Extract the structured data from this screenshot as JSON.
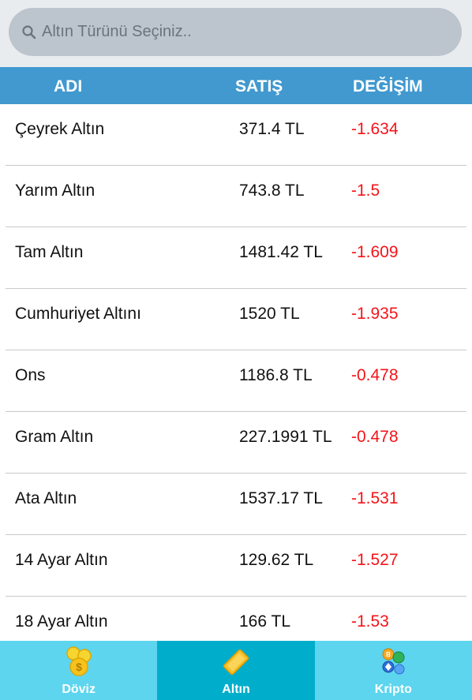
{
  "search": {
    "placeholder": "Altın Türünü Seçiniz.."
  },
  "table": {
    "headers": {
      "name": "ADI",
      "sale": "SATIŞ",
      "change": "DEĞİŞİM"
    },
    "rows": [
      {
        "name": "Çeyrek Altın",
        "sale": "371.4 TL",
        "change": "-1.634"
      },
      {
        "name": "Yarım Altın",
        "sale": "743.8 TL",
        "change": "-1.5"
      },
      {
        "name": "Tam Altın",
        "sale": "1481.42 TL",
        "change": "-1.609"
      },
      {
        "name": "Cumhuriyet Altını",
        "sale": "1520 TL",
        "change": "-1.935"
      },
      {
        "name": "Ons",
        "sale": "1186.8 TL",
        "change": "-0.478"
      },
      {
        "name": "Gram Altın",
        "sale": "227.1991 TL",
        "change": "-0.478"
      },
      {
        "name": "Ata Altın",
        "sale": "1537.17 TL",
        "change": "-1.531"
      },
      {
        "name": "14 Ayar Altın",
        "sale": "129.62 TL",
        "change": "-1.527"
      },
      {
        "name": "18 Ayar Altın",
        "sale": "166 TL",
        "change": "-1.53"
      }
    ]
  },
  "nav": {
    "items": [
      {
        "label": "Döviz",
        "icon": "coins-icon",
        "active": false
      },
      {
        "label": "Altın",
        "icon": "gold-bar-icon",
        "active": true
      },
      {
        "label": "Kripto",
        "icon": "crypto-coins-icon",
        "active": false
      }
    ]
  },
  "colors": {
    "header": "#4199cf",
    "negative": "#f4141a",
    "nav": "#5dd5ee",
    "nav_active": "#00aecb"
  }
}
